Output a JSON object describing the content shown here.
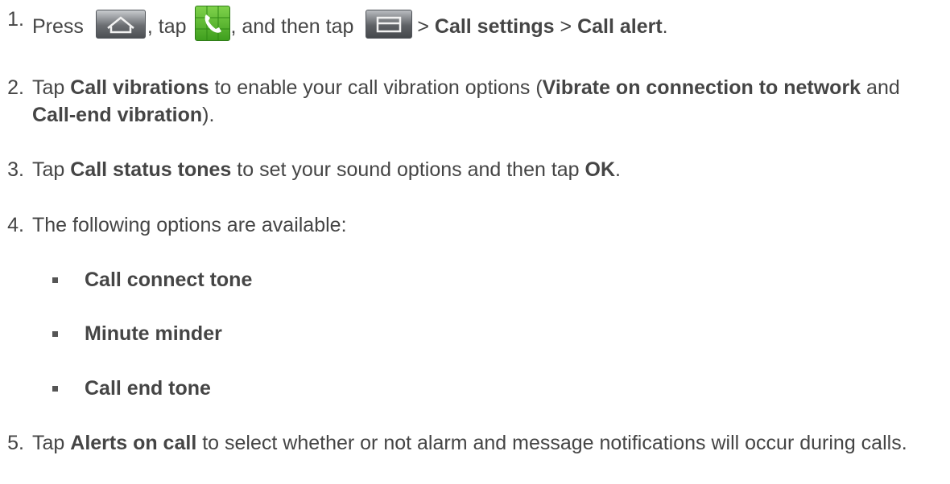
{
  "steps": [
    {
      "num": "1.",
      "parts": [
        "Press",
        ", tap",
        ", and then tap",
        ">",
        "Call settings",
        ">",
        "Call alert",
        "."
      ],
      "icons": [
        "home-key-icon",
        "phone-app-icon",
        "menu-key-icon"
      ]
    },
    {
      "num": "2.",
      "parts": [
        "Tap",
        "Call vibrations",
        "to enable your call vibration options (",
        "Vibrate on connection to network",
        "and",
        "Call-end vibration",
        ")."
      ]
    },
    {
      "num": "3.",
      "parts": [
        "Tap",
        "Call status tones",
        "to set your sound options and then tap",
        "OK",
        "."
      ]
    },
    {
      "num": "4.",
      "text": "The following options are available:",
      "options": [
        "Call connect tone",
        "Minute minder",
        "Call end tone"
      ]
    },
    {
      "num": "5.",
      "parts": [
        "Tap",
        "Alerts on call",
        "to select whether or not alarm and message notifications will occur during calls."
      ]
    }
  ]
}
